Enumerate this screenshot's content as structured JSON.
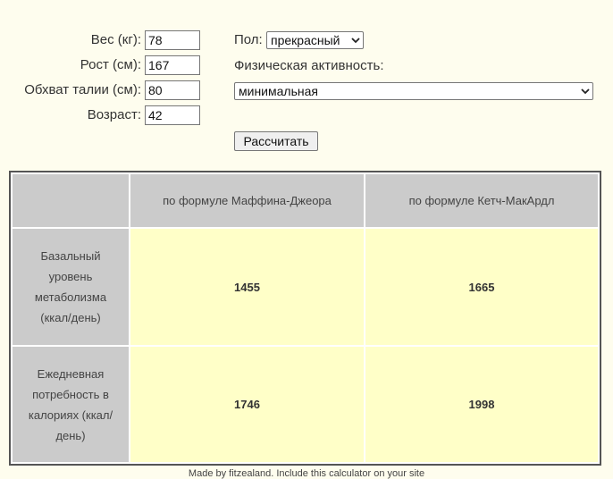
{
  "form": {
    "weight": {
      "label": "Вес (кг):",
      "value": "78"
    },
    "height": {
      "label": "Рост (см):",
      "value": "167"
    },
    "waist": {
      "label": "Обхват талии (см):",
      "value": "80"
    },
    "age": {
      "label": "Возраст:",
      "value": "42"
    },
    "sex": {
      "label": "Пол:",
      "selected": "прекрасный"
    },
    "activity": {
      "label": "Физическая активность:",
      "selected": "минимальная"
    },
    "calculate_label": "Рассчитать"
  },
  "results": {
    "columns": [
      "",
      "по формуле Маффина-Джеора",
      "по формуле Кетч-МакАрдл"
    ],
    "rows": [
      {
        "label": "Базальный уровень метаболизма (ккал/день)",
        "values": [
          "1455",
          "1665"
        ]
      },
      {
        "label": "Ежедневная потребность в калориях (ккал/день)",
        "values": [
          "1746",
          "1998"
        ]
      }
    ]
  },
  "footer": "Made by fitzealand. Include this calculator on your site"
}
